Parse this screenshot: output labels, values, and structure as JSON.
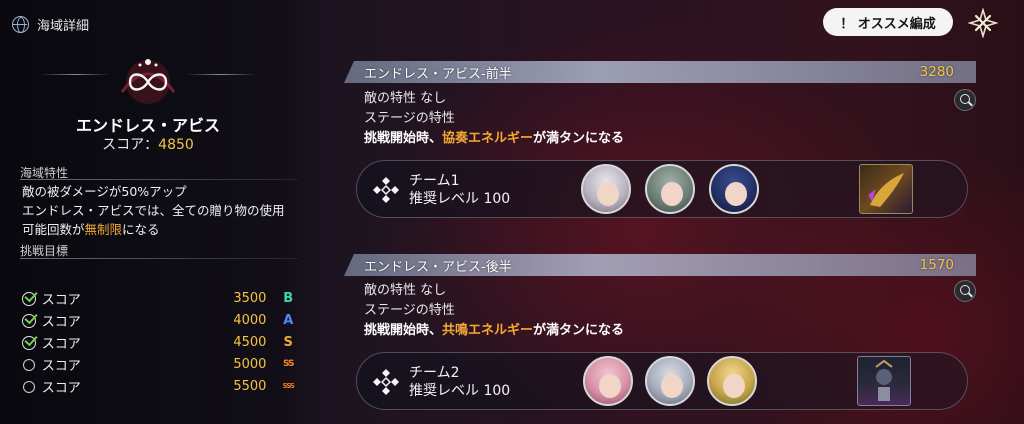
{
  "header": {
    "title": "海域詳細",
    "recommend_button": "！ オススメ編成"
  },
  "stage": {
    "name": "エンドレス・アビス",
    "score_label": "スコア：",
    "score_value": "4850"
  },
  "sea_traits": {
    "heading": "海域特性",
    "line1": "敵の被ダメージが50%アップ",
    "line2": "エンドレス・アビスでは、全ての贈り物の使用",
    "line3_pre": "可能回数が",
    "line3_hl": "無制限",
    "line3_post": "になる"
  },
  "goals": {
    "heading": "挑戦目標",
    "items": [
      {
        "label": "スコア",
        "value": "3500",
        "rank": "B",
        "done": true,
        "color": "#3fd9a8"
      },
      {
        "label": "スコア",
        "value": "4000",
        "rank": "A",
        "done": true,
        "color": "#4a8cff"
      },
      {
        "label": "スコア",
        "value": "4500",
        "rank": "S",
        "done": true,
        "color": "#f0a830"
      },
      {
        "label": "スコア",
        "value": "5000",
        "rank": "SS",
        "done": false,
        "color": "#f08a28"
      },
      {
        "label": "スコア",
        "value": "5500",
        "rank": "SSS",
        "done": false,
        "color": "#f07a20"
      }
    ]
  },
  "half1": {
    "title": "エンドレス・アビス-前半",
    "score": "3280",
    "enemy_trait": "敵の特性  なし",
    "stage_trait": "ステージの特性",
    "effect_pre": "挑戦開始時、",
    "effect_hl": "協奏エネルギー",
    "effect_post": "が満タンになる",
    "team_name": "チーム1",
    "team_level": "推奨レベル 100"
  },
  "half2": {
    "title": "エンドレス・アビス-後半",
    "score": "1570",
    "enemy_trait": "敵の特性  なし",
    "stage_trait": "ステージの特性",
    "effect_pre": "挑戦開始時、",
    "effect_hl": "共鳴エネルギー",
    "effect_post": "が満タンになる",
    "team_name": "チーム2",
    "team_level": "推奨レベル 100"
  }
}
